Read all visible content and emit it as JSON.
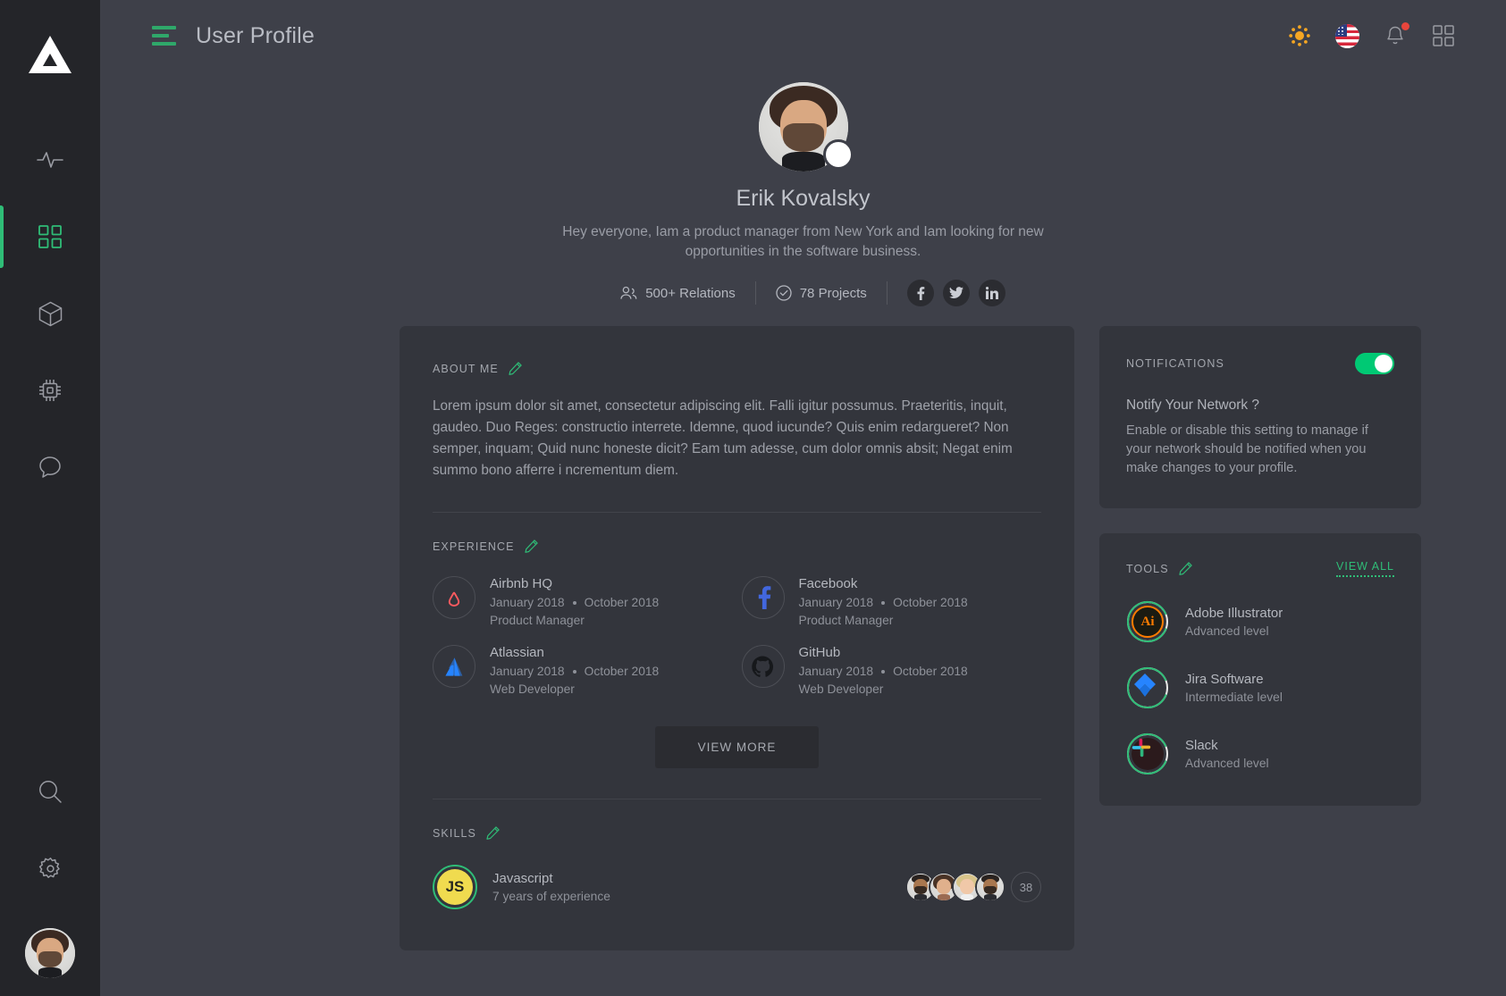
{
  "colors": {
    "accent_green": "#2fbd77",
    "toggle_on": "#00c974",
    "sidebar_bg": "#242529",
    "page_bg": "#3e4049",
    "card_bg": "#33353c",
    "sun_orange": "#f5a623",
    "notif_red": "#e8453c"
  },
  "sidebar": {
    "logo_name": "triangle-logo",
    "items": [
      {
        "icon": "activity-pulse-icon",
        "name": "activity",
        "active": false
      },
      {
        "icon": "grid-dashboard-icon",
        "name": "dashboard",
        "active": true
      },
      {
        "icon": "cube-icon",
        "name": "packages",
        "active": false
      },
      {
        "icon": "cpu-chip-icon",
        "name": "devices",
        "active": false
      },
      {
        "icon": "chat-bubble-icon",
        "name": "messages",
        "active": false
      }
    ],
    "bottom_items": [
      {
        "icon": "search-icon",
        "name": "search"
      },
      {
        "icon": "gear-icon",
        "name": "settings"
      }
    ],
    "avatar_name": "user-avatar"
  },
  "topbar": {
    "menu_icon": "hamburger-menu-icon",
    "title": "User Profile",
    "icons": [
      {
        "name": "sun-brightness-icon"
      },
      {
        "name": "flag-us-icon"
      },
      {
        "name": "bell-notification-icon",
        "has_badge": true
      },
      {
        "name": "apps-grid-icon"
      }
    ]
  },
  "profile": {
    "avatar_name": "profile-avatar",
    "flag_name": "flag-us-badge",
    "name": "Erik Kovalsky",
    "bio": "Hey everyone,  Iam a product manager from New York and Iam looking for new opportunities in the software business.",
    "stats": [
      {
        "icon": "users-icon",
        "label": "500+ Relations"
      },
      {
        "icon": "check-circle-icon",
        "label": "78 Projects"
      }
    ],
    "socials": [
      {
        "name": "facebook-icon"
      },
      {
        "name": "twitter-icon"
      },
      {
        "name": "linkedin-icon"
      }
    ]
  },
  "about": {
    "title": "ABOUT ME",
    "edit_icon": "pencil-edit-icon",
    "text": "Lorem ipsum dolor sit amet, consectetur adipiscing elit. Falli igitur possumus. Praeteritis, inquit, gaudeo. Duo Reges: constructio interrete. Idemne, quod iucunde? Quis enim redargueret? Non semper, inquam; Quid nunc honeste dicit? Eam tum adesse, cum dolor omnis absit; Negat enim summo bono afferre i ncrementum diem."
  },
  "experience": {
    "title": "EXPERIENCE",
    "edit_icon": "pencil-edit-icon",
    "items": [
      {
        "logo": "airbnb-logo",
        "company": "Airbnb HQ",
        "start": "January 2018",
        "end": "October 2018",
        "role": "Product Manager"
      },
      {
        "logo": "facebook-logo",
        "company": "Facebook",
        "start": "January 2018",
        "end": "October 2018",
        "role": "Product Manager"
      },
      {
        "logo": "atlassian-logo",
        "company": "Atlassian",
        "start": "January 2018",
        "end": "October 2018",
        "role": "Web Developer"
      },
      {
        "logo": "github-logo",
        "company": "GitHub",
        "start": "January 2018",
        "end": "October 2018",
        "role": "Web Developer"
      }
    ],
    "view_more_label": "VIEW MORE"
  },
  "skills": {
    "title": "SKILLS",
    "edit_icon": "pencil-edit-icon",
    "items": [
      {
        "badge_text": "JS",
        "name": "Javascript",
        "experience": "7 years of experience",
        "avatar_count": 4,
        "more_count": "38"
      }
    ]
  },
  "notifications": {
    "title": "NOTIFICATIONS",
    "toggle_on": true,
    "question": "Notify Your Network ?",
    "description": "Enable or disable this setting to manage if your network should be notified when you make changes to your profile."
  },
  "tools": {
    "title": "TOOLS",
    "edit_icon": "pencil-edit-icon",
    "view_all_label": "VIEW ALL",
    "items": [
      {
        "logo": "adobe-illustrator-logo",
        "name": "Adobe Illustrator",
        "level": "Advanced level",
        "progress": 88
      },
      {
        "logo": "jira-software-logo",
        "name": "Jira Software",
        "level": "Intermediate level",
        "progress": 88
      },
      {
        "logo": "slack-logo",
        "name": "Slack",
        "level": "Advanced level",
        "progress": 88
      }
    ]
  }
}
